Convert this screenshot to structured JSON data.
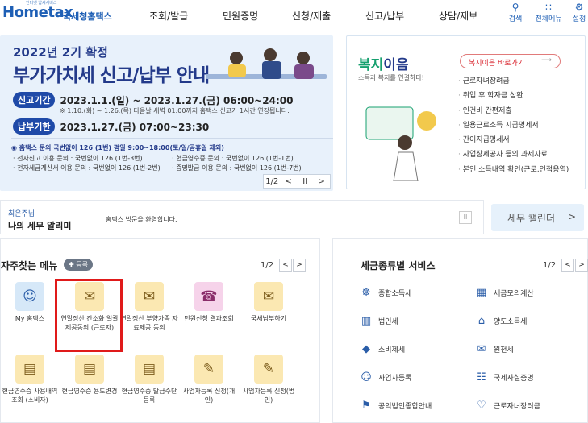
{
  "header": {
    "logo_small": "인터넷 납세서비스",
    "logo_main": "Hometax",
    "logo_sub": "국세청홈택스",
    "nav": [
      "조회/발급",
      "민원증명",
      "신청/제출",
      "신고/납부",
      "상담/제보"
    ],
    "icons": [
      {
        "label": "검색",
        "icon": "search-icon"
      },
      {
        "label": "전체메뉴",
        "icon": "grid-icon"
      },
      {
        "label": "설정",
        "icon": "gear-icon"
      }
    ]
  },
  "banner": {
    "title1": "2022년 2기 확정",
    "title2": "부가가치세 신고/납부 안내",
    "report_label": "신고기간",
    "report_period": "2023.1.1.(일) ~ 2023.1.27.(금) 06:00~24:00",
    "report_note": "※ 1.10.(화) ~ 1.26.(목) 다음날 새벽 01:00까지 홈택스 신고가 1시간 연장됩니다.",
    "pay_label": "납부기한",
    "pay_period": "2023.1.27.(금) 07:00~23:30",
    "inquiry": "◉ 홈택스 문의 국번없이 126 (1번) 평일 9:00~18:00(토/일/공휴일 제외)",
    "contacts": [
      "· 전자신고 이용 문의 : 국번없이 126 (1번-3번)",
      "· 현금영수증 문의 : 국번없이 126 (1번-1번)",
      "· 전자세금계산서 이용 문의 : 국번없이 126 (1번-2번)",
      "· 증명발급 이용 문의 : 국번없이 126 (1번-7번)"
    ],
    "pager": {
      "page": "1/2",
      "prev": "<",
      "pause": "II",
      "next": ">"
    }
  },
  "welfare": {
    "title_a": "복지",
    "title_b": "이음",
    "subtitle": "소득과 복지를 연결하다!",
    "button": "복지이음 바로가기",
    "items": [
      "근로자녀장려금",
      "취업 후 학자금 상환",
      "인건비 간편제출",
      "일용근로소득 지급명세서",
      "간이지급명세서",
      "사업장제공자 등의 과세자료",
      "본인 소득내역 확인(근로,인적용역)"
    ]
  },
  "notice": {
    "label_top": "최은주님",
    "label_bottom": "나의 세무 알리미",
    "message": "홈택스 방문을 환영합니다.",
    "pause": "II"
  },
  "calendar": {
    "label": "세무 캘린더",
    "arrow": ">"
  },
  "fav": {
    "title": "자주찾는 메뉴",
    "register": "✚ 등록",
    "page": "1/2",
    "items": [
      {
        "label": "My 홈택스",
        "icon": "person-icon",
        "color": "blue"
      },
      {
        "label": "연말정산 간소화 일괄제공동의 (근로자)",
        "icon": "document-icon",
        "color": "yellow"
      },
      {
        "label": "연말정산 부양가족 자료제공 동의",
        "icon": "document-icon",
        "color": "yellow"
      },
      {
        "label": "민원신청 결과조회",
        "icon": "headset-icon",
        "color": "pink"
      },
      {
        "label": "국세납부하기",
        "icon": "document-icon",
        "color": "yellow"
      },
      {
        "label": "현금영수증 사용내역조회 (소비자)",
        "icon": "receipt-icon",
        "color": "yellow"
      },
      {
        "label": "현금영수증 용도변경",
        "icon": "receipt-icon",
        "color": "yellow"
      },
      {
        "label": "현금영수증 발급수단 등록",
        "icon": "receipt-icon",
        "color": "yellow"
      },
      {
        "label": "사업자등록 신청(개인)",
        "icon": "person-pen-icon",
        "color": "yellow"
      },
      {
        "label": "사업자등록 신청(법인)",
        "icon": "person-pen-icon",
        "color": "yellow"
      }
    ]
  },
  "services": {
    "title": "세금종류별 서비스",
    "page": "1/2",
    "items": [
      {
        "label": "종합소득세",
        "icon": "car-icon"
      },
      {
        "label": "세금모의계산",
        "icon": "calculator-icon"
      },
      {
        "label": "법인세",
        "icon": "building-icon"
      },
      {
        "label": "양도소득세",
        "icon": "house-icon"
      },
      {
        "label": "소비제세",
        "icon": "diamond-icon"
      },
      {
        "label": "원천세",
        "icon": "document-icon"
      },
      {
        "label": "사업자등록",
        "icon": "person-icon"
      },
      {
        "label": "국세사실증명",
        "icon": "certificate-icon"
      },
      {
        "label": "공익법인종합안내",
        "icon": "badge-icon"
      },
      {
        "label": "근로자녀장려금",
        "icon": "heart-icon"
      }
    ]
  }
}
